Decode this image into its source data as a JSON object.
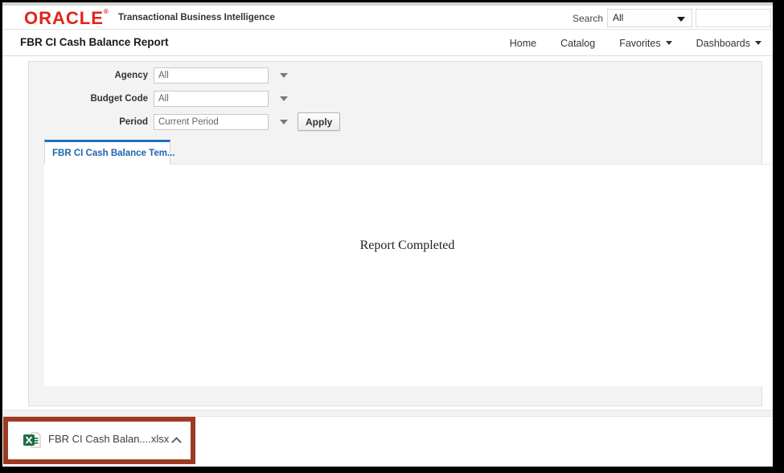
{
  "header": {
    "logo_text": "ORACLE",
    "logo_mark": "®",
    "product_name": "Transactional Business Intelligence",
    "search": {
      "label": "Search",
      "scope_value": "All",
      "input_value": "",
      "input_placeholder": ""
    }
  },
  "titlebar": {
    "title": "FBR CI Cash Balance Report",
    "nav": [
      {
        "label": "Home"
      },
      {
        "label": "Catalog"
      },
      {
        "label": "Favorites"
      },
      {
        "label": "Dashboards"
      }
    ]
  },
  "filters": {
    "fields": [
      {
        "label": "Agency",
        "value": "All"
      },
      {
        "label": "Budget Code",
        "value": "All"
      },
      {
        "label": "Period",
        "value": "Current Period"
      }
    ],
    "apply_label": "Apply"
  },
  "report": {
    "tab_label": "FBR CI Cash Balance Tem...",
    "status_text": "Report Completed"
  },
  "download_shelf": {
    "file_name": "FBR CI Cash Balan....xlsx",
    "file_type": "xlsx"
  },
  "annotation": {
    "highlight_color": "#9e3a22"
  },
  "colors": {
    "oracle_red": "#e2231a",
    "tab_blue": "#1d72c0",
    "tab_text_blue": "#1b64ad",
    "panel_bg": "#f3f3f3",
    "excel_green": "#1d6f42"
  }
}
